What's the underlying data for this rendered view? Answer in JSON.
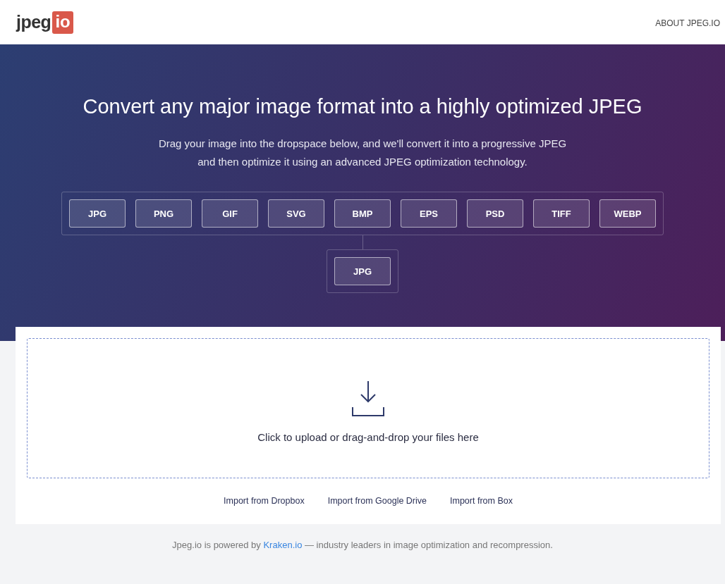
{
  "header": {
    "logo": {
      "text": "jpeg",
      "badge": "io"
    },
    "nav": [
      "ABOUT JPEG.IO"
    ]
  },
  "hero": {
    "title": "Convert any major image format into a highly optimized JPEG",
    "subtitle_lines": [
      "Drag your image into the dropspace below, and we'll convert it into a progressive JPEG",
      "and then optimize it using an advanced JPEG optimization technology."
    ],
    "input_formats": [
      "JPG",
      "PNG",
      "GIF",
      "SVG",
      "BMP",
      "EPS",
      "PSD",
      "TIFF",
      "WEBP"
    ],
    "output_format": "JPG"
  },
  "dropzone": {
    "label": "Click to upload or drag-and-drop your files here"
  },
  "imports": [
    "Import from Dropbox",
    "Import from Google Drive",
    "Import from Box"
  ],
  "footer": {
    "before": "Jpeg.io is powered by",
    "link": "Kraken.io",
    "after": "— industry leaders in image optimization and recompression."
  }
}
